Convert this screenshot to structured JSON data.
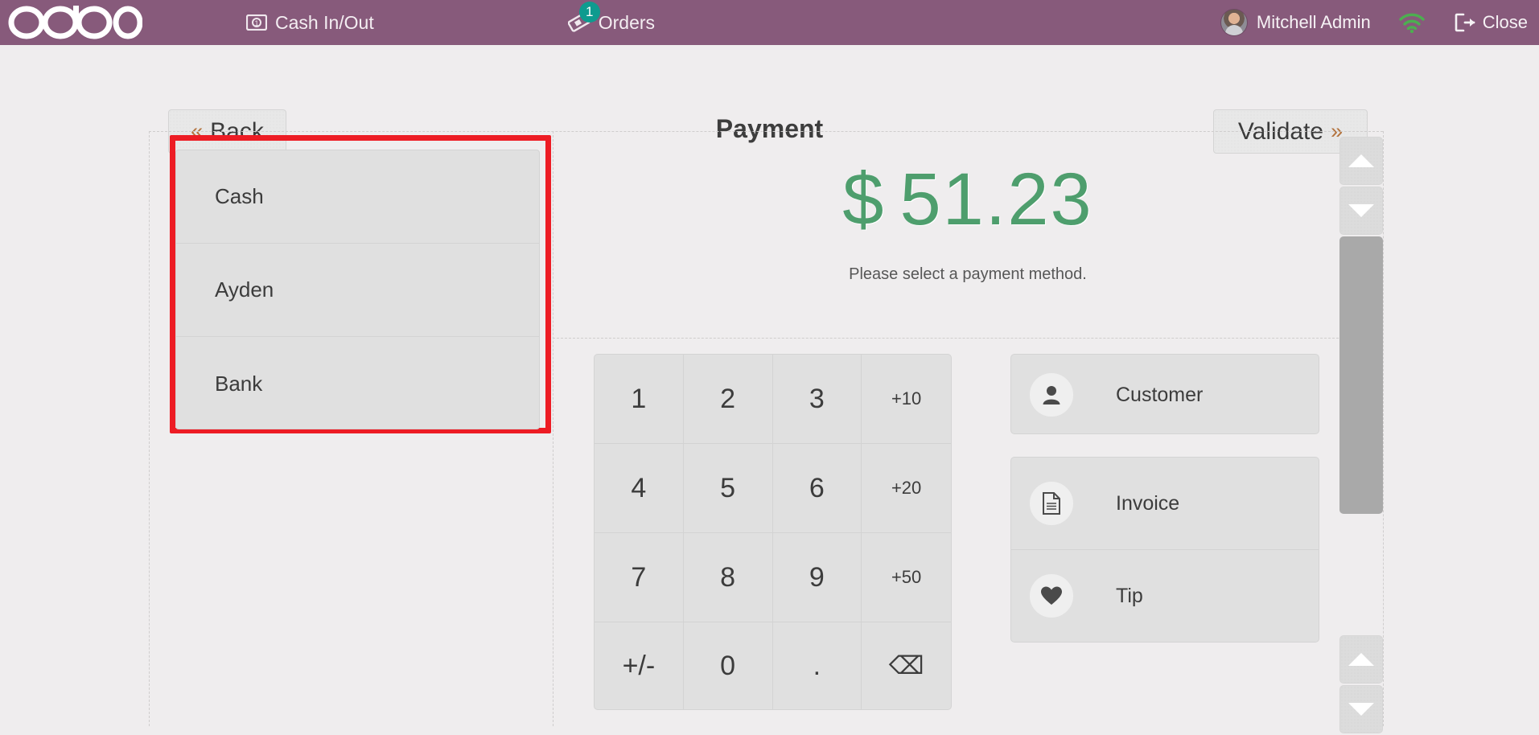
{
  "topbar": {
    "logo": "odoo",
    "cash_in_out": {
      "label": "Cash In/Out",
      "icon": "banknote-icon"
    },
    "orders": {
      "label": "Orders",
      "badge": "1",
      "icon": "ticket-icon"
    },
    "user": "Mitchell Admin",
    "close": "Close",
    "colors": {
      "bar": "#875a7b",
      "badge": "#0e9b8f",
      "wifi": "#4caf50"
    }
  },
  "subheader": {
    "back_label": "Back",
    "back_chevron": "«",
    "title": "Payment",
    "validate_label": "Validate",
    "validate_chevron": "»"
  },
  "payment_methods": {
    "highlight_color": "#ed1c24",
    "items": [
      {
        "label": "Cash"
      },
      {
        "label": "Ayden"
      },
      {
        "label": "Bank"
      }
    ]
  },
  "amount": {
    "currency": "$",
    "value": "51.23",
    "color": "#4e9e6d",
    "hint": "Please select a payment method."
  },
  "numpad": {
    "keys": [
      {
        "label": "1",
        "kind": "digit"
      },
      {
        "label": "2",
        "kind": "digit"
      },
      {
        "label": "3",
        "kind": "digit"
      },
      {
        "label": "+10",
        "kind": "preset"
      },
      {
        "label": "4",
        "kind": "digit"
      },
      {
        "label": "5",
        "kind": "digit"
      },
      {
        "label": "6",
        "kind": "digit"
      },
      {
        "label": "+20",
        "kind": "preset"
      },
      {
        "label": "7",
        "kind": "digit"
      },
      {
        "label": "8",
        "kind": "digit"
      },
      {
        "label": "9",
        "kind": "digit"
      },
      {
        "label": "+50",
        "kind": "preset"
      },
      {
        "label": "+/-",
        "kind": "sign"
      },
      {
        "label": "0",
        "kind": "digit"
      },
      {
        "label": ".",
        "kind": "decimal"
      },
      {
        "label": "⌫",
        "kind": "backspace"
      }
    ]
  },
  "actions": {
    "customer": {
      "label": "Customer",
      "icon": "person-icon"
    },
    "invoice": {
      "label": "Invoice",
      "icon": "document-icon"
    },
    "tip": {
      "label": "Tip",
      "icon": "heart-icon"
    }
  },
  "scrollbar": {
    "up": "▲",
    "down": "▼"
  }
}
